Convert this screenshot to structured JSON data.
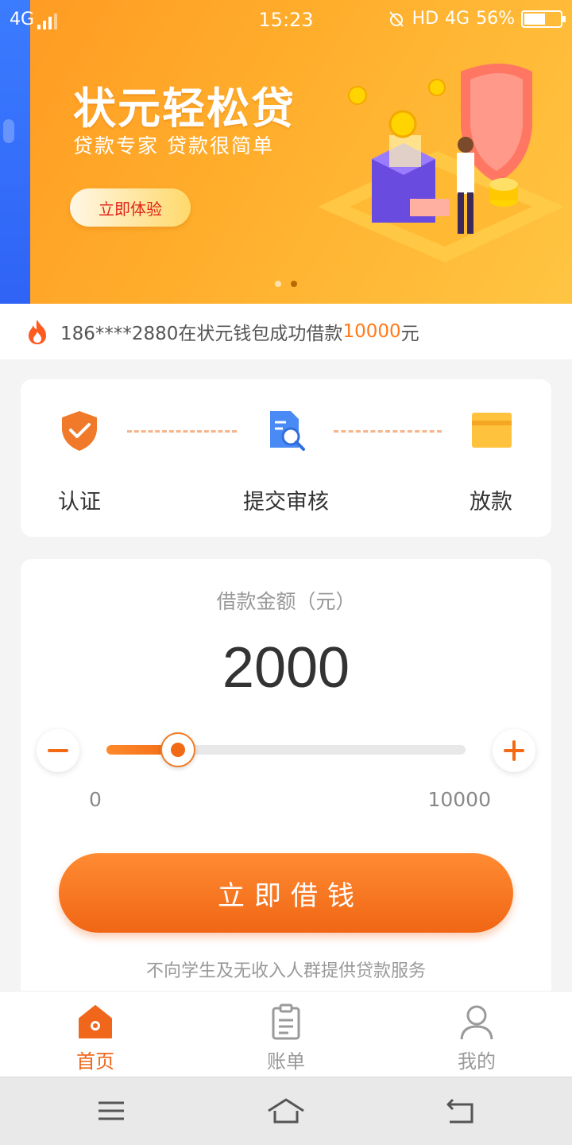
{
  "status_bar": {
    "network": "4G",
    "time": "15:23",
    "right_text": "HD",
    "network_right": "4G",
    "battery": "56%"
  },
  "banner": {
    "title": "状元轻松贷",
    "subtitle": "贷款专家 贷款很简单",
    "cta_label": "立即体验",
    "page_count": 2,
    "active_page": 2
  },
  "ticker": {
    "prefix": "186****2880在状元钱包成功借款",
    "amount": "10000",
    "suffix": "元"
  },
  "steps": [
    {
      "label": "认证",
      "icon": "shield-check-icon"
    },
    {
      "label": "提交审核",
      "icon": "document-search-icon"
    },
    {
      "label": "放款",
      "icon": "wallet-icon"
    }
  ],
  "loan": {
    "label": "借款金额（元）",
    "amount": "2000",
    "min": "0",
    "max": "10000",
    "slider_fraction": 0.2,
    "button_label": "立即借钱",
    "note": "不向学生及无收入人群提供贷款服务"
  },
  "tabs": [
    {
      "label": "首页",
      "icon": "home-icon",
      "active": true
    },
    {
      "label": "账单",
      "icon": "clipboard-icon",
      "active": false
    },
    {
      "label": "我的",
      "icon": "user-icon",
      "active": false
    }
  ],
  "colors": {
    "accent": "#f0661a",
    "banner_orange": "#ffae2c",
    "ticker_amount": "#ff7a1a"
  }
}
